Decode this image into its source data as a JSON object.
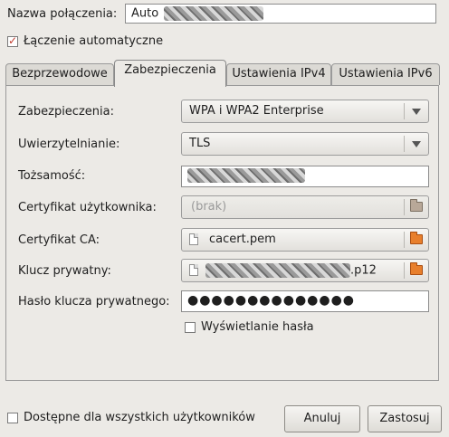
{
  "connection": {
    "name_label": "Nazwa połączenia:",
    "name_value": "Auto"
  },
  "autoconnect": {
    "label": "Łączenie automatyczne",
    "checked": true
  },
  "tabs": [
    {
      "label": "Bezprzewodowe"
    },
    {
      "label": "Zabezpieczenia"
    },
    {
      "label": "Ustawienia IPv4"
    },
    {
      "label": "Ustawienia IPv6"
    }
  ],
  "active_tab": 1,
  "security": {
    "security_label": "Zabezpieczenia:",
    "security_value": "WPA i WPA2 Enterprise",
    "auth_label": "Uwierzytelnianie:",
    "auth_value": "TLS",
    "identity_label": "Tożsamość:",
    "user_cert_label": "Certyfikat użytkownika:",
    "user_cert_value": "(brak)",
    "ca_cert_label": "Certyfikat CA:",
    "ca_cert_value": "cacert.pem",
    "private_key_label": "Klucz prywatny:",
    "private_key_suffix": ".p12",
    "key_password_label": "Hasło klucza prywatnego:",
    "key_password_value": "●●●●●●●●●●●●●●",
    "show_password_label": "Wyświetlanie hasła"
  },
  "footer": {
    "all_users_label": "Dostępne dla wszystkich użytkowników",
    "cancel_label": "Anuluj",
    "apply_label": "Zastosuj"
  }
}
